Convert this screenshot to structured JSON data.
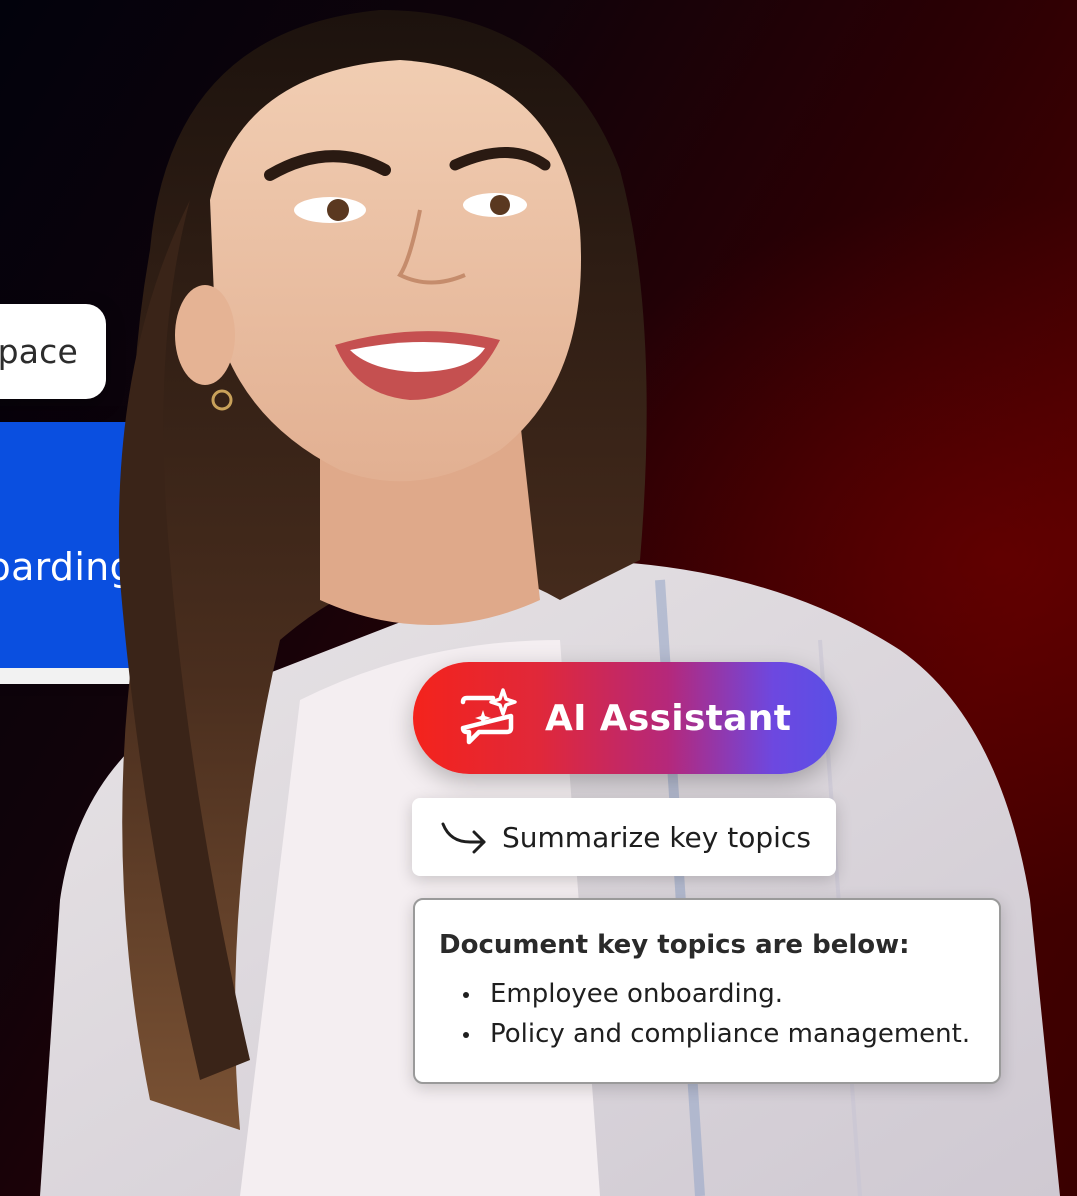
{
  "left_cards": {
    "space_label": "Space",
    "onboarding_label": "oarding"
  },
  "ai_assistant": {
    "icon": "ai-chat-sparkle-icon",
    "label": "AI Assistant",
    "gradient": [
      "#f4231c",
      "#b5287a",
      "#5a4fe6"
    ]
  },
  "prompt": {
    "icon": "reply-arrow-icon",
    "text": "Summarize key topics"
  },
  "answer": {
    "title": "Document key topics are below:",
    "items": [
      "Employee onboarding.",
      "Policy and compliance management."
    ]
  },
  "colors": {
    "onboarding_blue": "#0a4fe0",
    "background_dark": "#02020c",
    "background_red": "#470000"
  }
}
